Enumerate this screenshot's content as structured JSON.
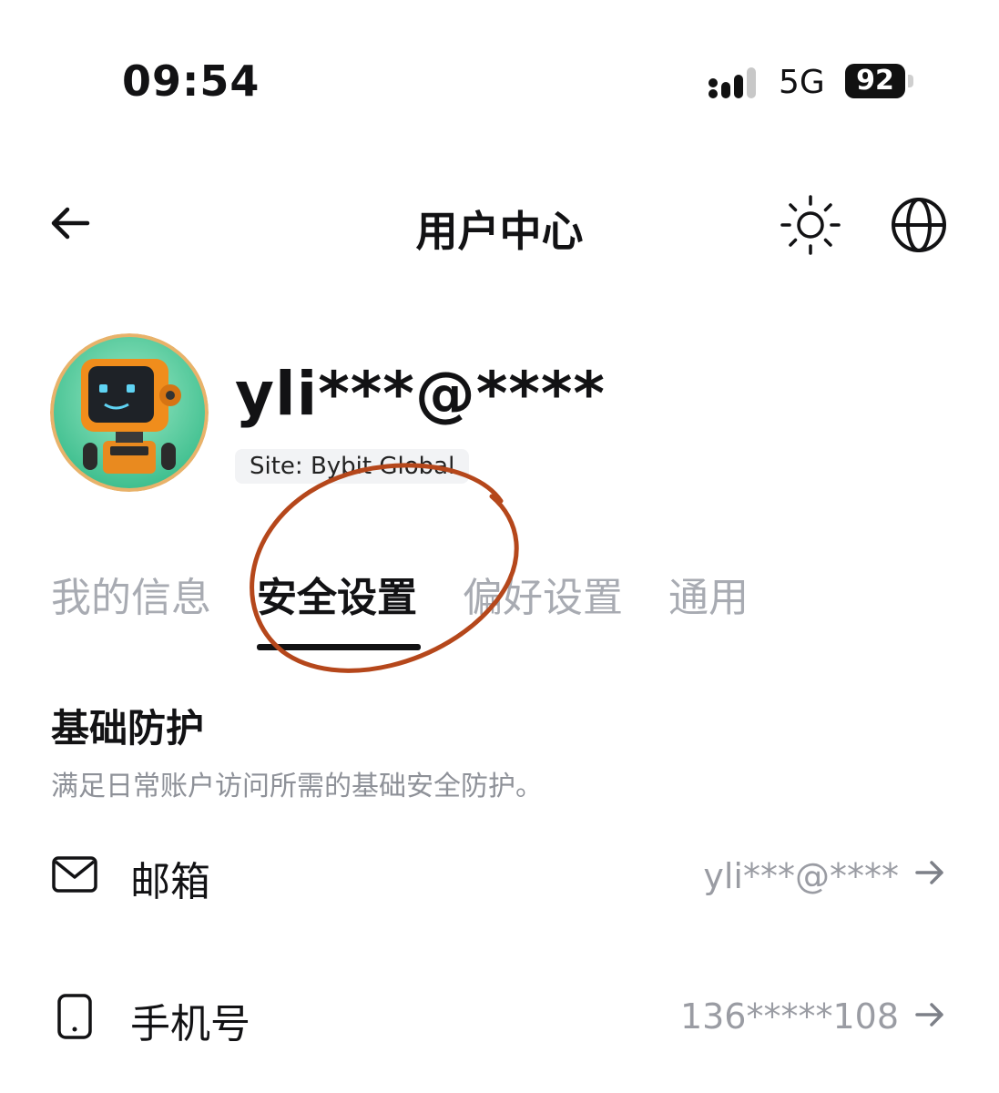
{
  "status_bar": {
    "time": "09:54",
    "network": "5G",
    "battery": "92"
  },
  "header": {
    "title": "用户中心",
    "back_icon": "arrow-left-icon",
    "theme_icon": "sun-icon",
    "language_icon": "globe-icon"
  },
  "profile": {
    "username": "yli***@****",
    "site": "Site: Bybit Global",
    "avatar": "robot-avatar"
  },
  "tabs": [
    {
      "label": "我的信息",
      "active": false
    },
    {
      "label": "安全设置",
      "active": true
    },
    {
      "label": "偏好设置",
      "active": false
    },
    {
      "label": "通用",
      "active": false
    }
  ],
  "section": {
    "title": "基础防护",
    "description": "满足日常账户访问所需的基础安全防护。",
    "items": [
      {
        "label": "邮箱",
        "value": "yli***@****",
        "icon": "mail-icon"
      },
      {
        "label": "手机号",
        "value": "136*****108",
        "icon": "phone-icon"
      }
    ]
  },
  "colors": {
    "annotation": "#b5471b",
    "text": "#121214",
    "muted": "#a8abb2"
  }
}
